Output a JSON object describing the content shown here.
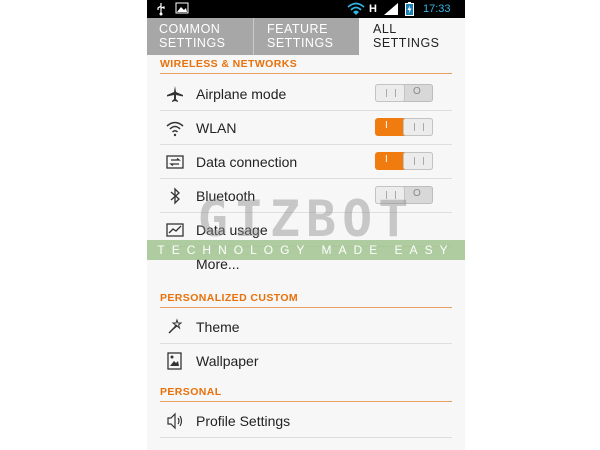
{
  "status_bar": {
    "network_type": "H",
    "time": "17:33",
    "icons": [
      "usb-icon",
      "image-icon",
      "wifi-icon",
      "signal-icon",
      "battery-icon"
    ]
  },
  "tabs": [
    {
      "label_line1": "COMMON",
      "label_line2": "SETTINGS"
    },
    {
      "label_line1": "FEATURE",
      "label_line2": "SETTINGS"
    },
    {
      "label_line1": "ALL",
      "label_line2": "SETTINGS"
    }
  ],
  "sections": {
    "wireless": "WIRELESS & NETWORKS",
    "personalized": "PERSONALIZED CUSTOM",
    "personal": "PERSONAL"
  },
  "items": {
    "airplane": {
      "label": "Airplane mode",
      "toggle": "off",
      "icon": "airplane-icon"
    },
    "wlan": {
      "label": "WLAN",
      "toggle": "on",
      "icon": "wifi-icon"
    },
    "data": {
      "label": "Data connection",
      "toggle": "on",
      "icon": "data-connection-icon"
    },
    "bluetooth": {
      "label": "Bluetooth",
      "toggle": "off",
      "icon": "bluetooth-icon"
    },
    "data_usage": {
      "label": "Data usage",
      "icon": "data-usage-icon"
    },
    "more": {
      "label": "More..."
    },
    "theme": {
      "label": "Theme",
      "icon": "theme-icon"
    },
    "wallpaper": {
      "label": "Wallpaper",
      "icon": "wallpaper-icon"
    },
    "profile": {
      "label": "Profile Settings",
      "icon": "speaker-icon"
    }
  },
  "toggle_marks": {
    "on": "I",
    "off": "O"
  },
  "watermark": {
    "title": "GIZBOT",
    "tagline": "TECHNOLOGY MADE EASY"
  },
  "colors": {
    "accent": "#f07c10",
    "section_text": "#e8710a",
    "time": "#33b5e5"
  }
}
